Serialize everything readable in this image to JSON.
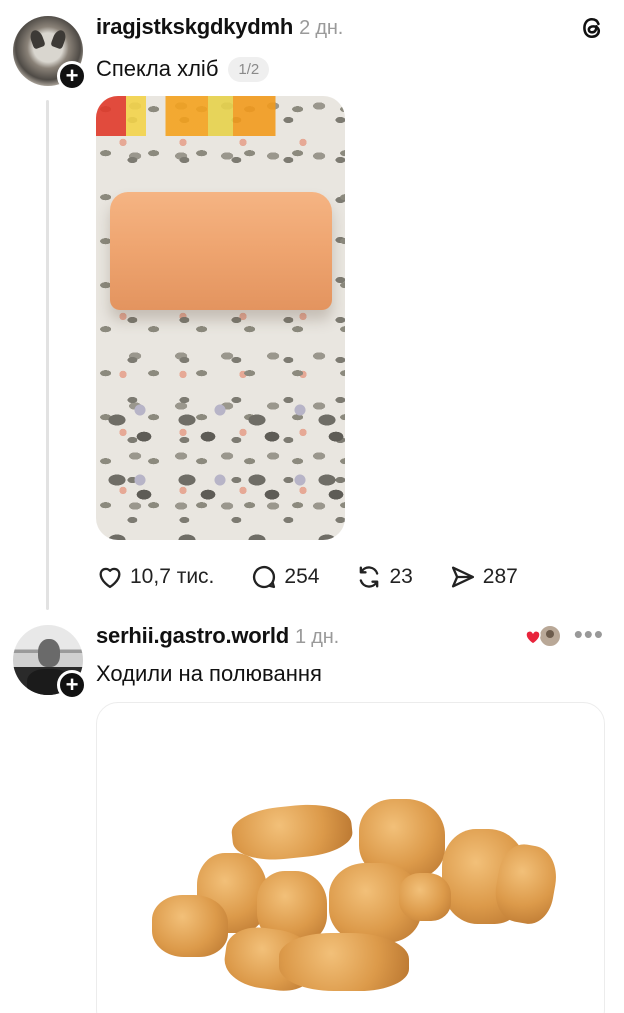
{
  "threads_logo_icon": "threads-logo-icon",
  "posts": [
    {
      "username": "iragjstkskgdkydmh",
      "time": "2 дн.",
      "caption": "Спекла хліб",
      "page_indicator": "1/2",
      "actions": {
        "likes": "10,7 тис.",
        "comments": "254",
        "reposts": "23",
        "shares": "287"
      }
    },
    {
      "username": "serhii.gastro.world",
      "time": "1 дн.",
      "caption": "Ходили на полювання",
      "more": "•••"
    }
  ],
  "colors": {
    "heart_reaction": "#e8243c",
    "thread_line": "#e2e2e2",
    "muted_text": "#9a9a9a"
  }
}
